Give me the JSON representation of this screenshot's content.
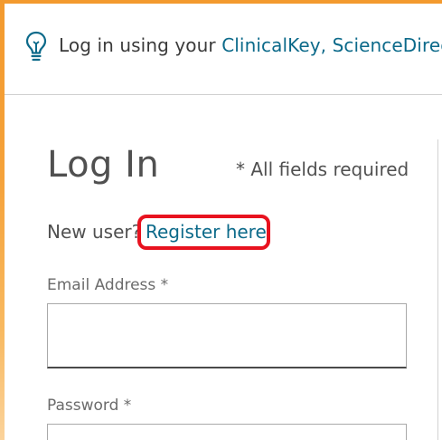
{
  "banner": {
    "prefix": "Log in using your ",
    "link_text": "ClinicalKey, ScienceDirect"
  },
  "login": {
    "title": "Log In",
    "required_note": "* All fields required",
    "new_user_label": "New user?",
    "register_link": "Register here",
    "email_label": "Email Address *",
    "email_value": "",
    "password_label": "Password *",
    "password_value": ""
  },
  "icons": {
    "banner_icon": "lightbulb-icon"
  },
  "colors": {
    "accent_orange": "#f39a2e",
    "link": "#0c6a8a",
    "highlight": "#e8121f",
    "text": "#505050"
  }
}
